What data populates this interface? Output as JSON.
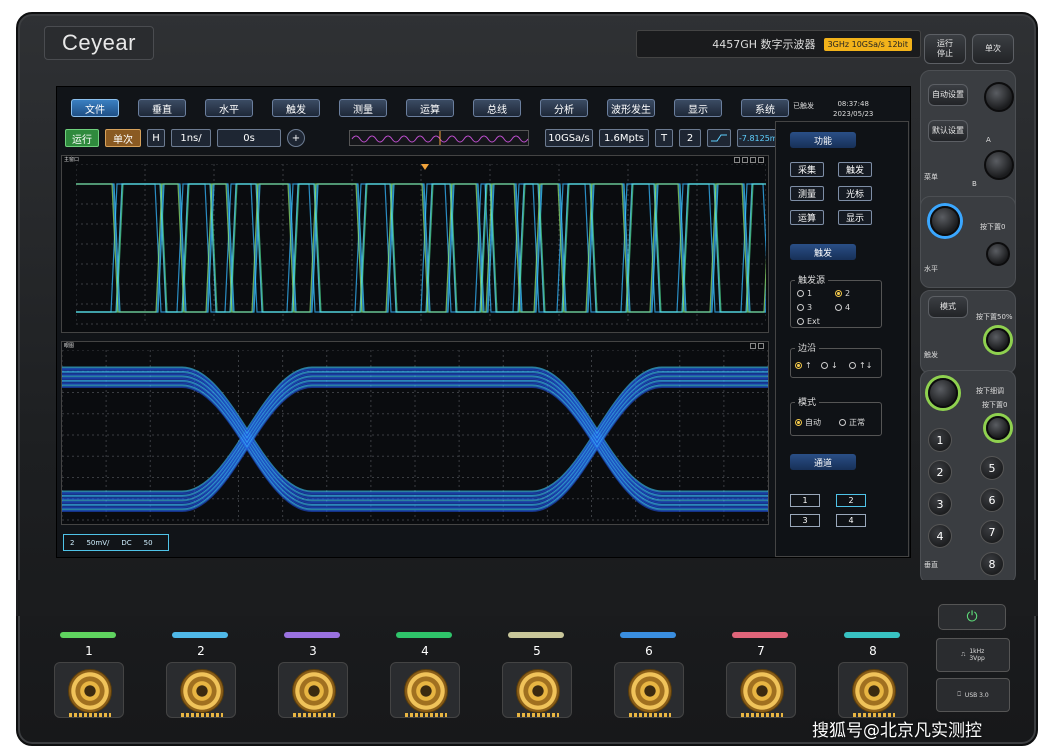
{
  "brand": {
    "logo": "Ceyear",
    "model": "4457GH 数字示波器",
    "spec": "3GHz 10GSa/s 12bit"
  },
  "menu": {
    "items": [
      "文件",
      "垂直",
      "水平",
      "触发",
      "测量",
      "运算",
      "总线",
      "分析",
      "波形发生",
      "显示",
      "系统"
    ]
  },
  "status": {
    "state": "已触发",
    "time": "08:37:48",
    "date": "2023/05/23"
  },
  "toolbar": {
    "run": "运行",
    "single": "单次",
    "h": "H",
    "timebase": "1ns/",
    "delay": "0s",
    "sample_rate": "10GSa/s",
    "memory": "1.6Mpts",
    "t": "T",
    "trig_channel": "2",
    "trig_level": "-7.8125mV"
  },
  "windows": {
    "main_title": "主窗口",
    "eye_title": "眼图"
  },
  "channel_info": {
    "channel": "2",
    "scale": "50mV/",
    "coupling": "DC",
    "impedance": "50"
  },
  "side": {
    "function_head": "功能",
    "functions": [
      "采集",
      "触发",
      "测量",
      "光标",
      "运算",
      "显示"
    ],
    "trigger_head": "触发",
    "source_title": "触发源",
    "sources": [
      "1",
      "2",
      "3",
      "4",
      "Ext"
    ],
    "edge_title": "边沿",
    "mode_title": "模式",
    "mode_auto": "自动",
    "mode_normal": "正常",
    "channel_head": "通道",
    "channels": [
      "1",
      "2",
      "3",
      "4"
    ]
  },
  "hardware": {
    "run_stop": "运行\n停止",
    "single": "单次",
    "auto_setup": "自动设置",
    "default_setup": "默认设置",
    "menu_label": "菜单",
    "knob_a": "A",
    "knob_b": "B",
    "push_zero_1": "按下置0",
    "horizontal_label": "水平",
    "mode": "模式",
    "push_50": "按下置50%",
    "trigger_label": "触发",
    "push_fine": "按下细调",
    "push_zero_2": "按下置0",
    "vertical_label": "垂直",
    "numbers": [
      "1",
      "2",
      "3",
      "4",
      "5",
      "6",
      "7",
      "8"
    ]
  },
  "inputs": {
    "labels": [
      "1",
      "2",
      "3",
      "4",
      "5",
      "6",
      "7",
      "8"
    ],
    "colors": [
      "#5fd35f",
      "#4fb8e8",
      "#9a72e0",
      "#2fc46a",
      "#c9c79a",
      "#3a8ee0",
      "#e0657a",
      "#38c2c2"
    ],
    "probe_comp": "1kHz\n3Vpp",
    "usb": "USB 3.0"
  },
  "watermark": "搜狐号@北京凡实测控"
}
